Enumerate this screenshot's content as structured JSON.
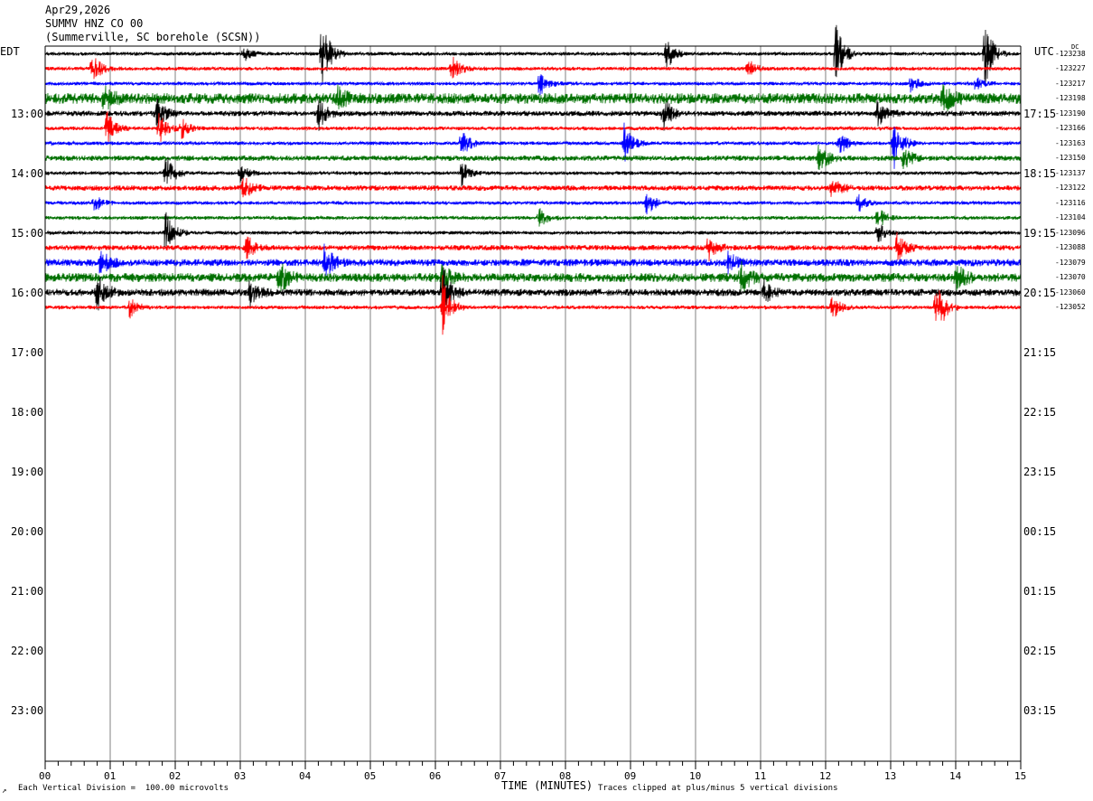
{
  "header": {
    "date": "Apr29,2026",
    "station": "SUMMV HNZ CO 00",
    "location": "(Summerville, SC borehole (SCSN))"
  },
  "left_axis_label": "EDT",
  "right_axis_label": "UTC",
  "dc_label": "DC",
  "footer": {
    "scale_note": "Each Vertical Division =  100.00 microvolts",
    "clip_note": "Traces clipped at plus/minus 5 vertical divisions",
    "corner_mark": "↗"
  },
  "colors": {
    "trace_cycle": [
      "#000000",
      "#ff0000",
      "#0000ff",
      "#007000"
    ],
    "grid": "#808080",
    "background": "#ffffff"
  },
  "chart_data": {
    "type": "line",
    "title": "SUMMV HNZ CO 00",
    "xlabel": "TIME (MINUTES)",
    "ylabel": "",
    "xlim": [
      0,
      15
    ],
    "x_ticks": [
      "00",
      "01",
      "02",
      "03",
      "04",
      "05",
      "06",
      "07",
      "08",
      "09",
      "10",
      "11",
      "12",
      "13",
      "14",
      "15"
    ],
    "left_hour_labels": [
      "13:00",
      "14:00",
      "15:00",
      "16:00",
      "17:00",
      "18:00",
      "19:00",
      "20:00",
      "21:00",
      "22:00",
      "23:00"
    ],
    "right_hour_labels": [
      "17:15",
      "18:15",
      "19:15",
      "20:15",
      "21:15",
      "22:15",
      "23:15",
      "00:15",
      "01:15",
      "02:15",
      "03:15"
    ],
    "lines_per_hour": 4,
    "trace_offsets": [
      "-123238",
      "-123227",
      "-123217",
      "-123198",
      "-123190",
      "-123166",
      "-123163",
      "-123150",
      "-123137",
      "-123122",
      "-123116",
      "-123104",
      "-123096",
      "-123088",
      "-123079",
      "-123070",
      "-123060",
      "-123052"
    ],
    "trace_colors": [
      "black",
      "red",
      "blue",
      "green",
      "black",
      "red",
      "blue",
      "green",
      "black",
      "red",
      "blue",
      "green",
      "black",
      "red",
      "blue",
      "green",
      "black",
      "red"
    ],
    "noise_level": [
      2,
      2,
      2,
      6,
      3,
      2,
      2,
      3,
      2,
      3,
      2,
      2,
      2,
      3,
      4,
      5,
      4,
      2
    ],
    "events": [
      {
        "trace": 0,
        "minute": 4.25,
        "amp": 40
      },
      {
        "trace": 0,
        "minute": 9.55,
        "amp": 18
      },
      {
        "trace": 0,
        "minute": 12.15,
        "amp": 35
      },
      {
        "trace": 0,
        "minute": 14.45,
        "amp": 38
      },
      {
        "trace": 0,
        "minute": 3.05,
        "amp": 8
      },
      {
        "trace": 1,
        "minute": 0.72,
        "amp": 18
      },
      {
        "trace": 1,
        "minute": 6.25,
        "amp": 15
      },
      {
        "trace": 1,
        "minute": 10.8,
        "amp": 12
      },
      {
        "trace": 2,
        "minute": 7.6,
        "amp": 14
      },
      {
        "trace": 2,
        "minute": 13.3,
        "amp": 10
      },
      {
        "trace": 2,
        "minute": 14.3,
        "amp": 8
      },
      {
        "trace": 3,
        "minute": 0.9,
        "amp": 14
      },
      {
        "trace": 3,
        "minute": 4.5,
        "amp": 12
      },
      {
        "trace": 3,
        "minute": 13.8,
        "amp": 16
      },
      {
        "trace": 4,
        "minute": 1.7,
        "amp": 22
      },
      {
        "trace": 4,
        "minute": 4.2,
        "amp": 18
      },
      {
        "trace": 4,
        "minute": 9.5,
        "amp": 20
      },
      {
        "trace": 4,
        "minute": 12.8,
        "amp": 16
      },
      {
        "trace": 5,
        "minute": 0.95,
        "amp": 20
      },
      {
        "trace": 5,
        "minute": 1.75,
        "amp": 18
      },
      {
        "trace": 5,
        "minute": 2.1,
        "amp": 12
      },
      {
        "trace": 6,
        "minute": 6.4,
        "amp": 16
      },
      {
        "trace": 6,
        "minute": 8.9,
        "amp": 22
      },
      {
        "trace": 6,
        "minute": 13.05,
        "amp": 30
      },
      {
        "trace": 6,
        "minute": 12.2,
        "amp": 14
      },
      {
        "trace": 7,
        "minute": 11.9,
        "amp": 18
      },
      {
        "trace": 7,
        "minute": 13.2,
        "amp": 14
      },
      {
        "trace": 8,
        "minute": 1.85,
        "amp": 22
      },
      {
        "trace": 8,
        "minute": 6.4,
        "amp": 14
      },
      {
        "trace": 8,
        "minute": 3.0,
        "amp": 10
      },
      {
        "trace": 9,
        "minute": 3.05,
        "amp": 14
      },
      {
        "trace": 9,
        "minute": 12.1,
        "amp": 12
      },
      {
        "trace": 10,
        "minute": 0.75,
        "amp": 10
      },
      {
        "trace": 10,
        "minute": 9.25,
        "amp": 14
      },
      {
        "trace": 10,
        "minute": 12.5,
        "amp": 10
      },
      {
        "trace": 11,
        "minute": 7.6,
        "amp": 10
      },
      {
        "trace": 11,
        "minute": 12.8,
        "amp": 12
      },
      {
        "trace": 12,
        "minute": 1.85,
        "amp": 24
      },
      {
        "trace": 12,
        "minute": 12.8,
        "amp": 12
      },
      {
        "trace": 13,
        "minute": 3.1,
        "amp": 14
      },
      {
        "trace": 13,
        "minute": 10.2,
        "amp": 14
      },
      {
        "trace": 13,
        "minute": 13.1,
        "amp": 16
      },
      {
        "trace": 14,
        "minute": 4.3,
        "amp": 22
      },
      {
        "trace": 14,
        "minute": 0.85,
        "amp": 14
      },
      {
        "trace": 14,
        "minute": 10.5,
        "amp": 12
      },
      {
        "trace": 15,
        "minute": 3.6,
        "amp": 20
      },
      {
        "trace": 15,
        "minute": 6.1,
        "amp": 14
      },
      {
        "trace": 15,
        "minute": 10.7,
        "amp": 18
      },
      {
        "trace": 15,
        "minute": 14.0,
        "amp": 16
      },
      {
        "trace": 16,
        "minute": 0.8,
        "amp": 26
      },
      {
        "trace": 16,
        "minute": 3.15,
        "amp": 14
      },
      {
        "trace": 16,
        "minute": 6.1,
        "amp": 30
      },
      {
        "trace": 16,
        "minute": 11.05,
        "amp": 12
      },
      {
        "trace": 17,
        "minute": 6.1,
        "amp": 38
      },
      {
        "trace": 17,
        "minute": 13.7,
        "amp": 40
      },
      {
        "trace": 17,
        "minute": 12.1,
        "amp": 14
      },
      {
        "trace": 17,
        "minute": 1.3,
        "amp": 12
      }
    ]
  }
}
